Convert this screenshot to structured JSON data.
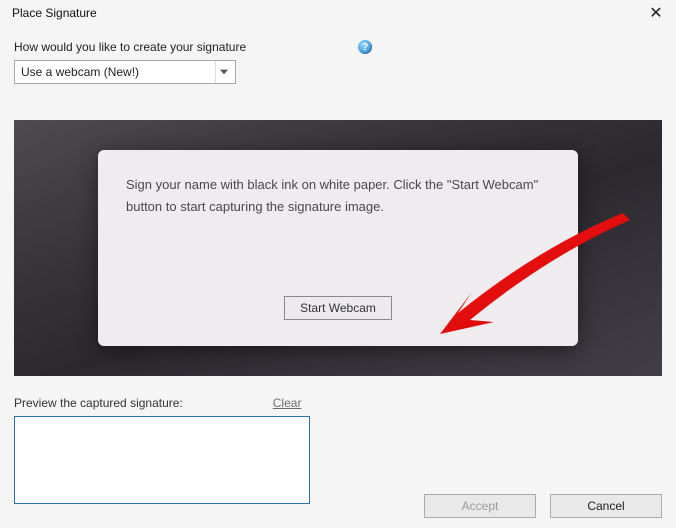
{
  "title": "Place Signature",
  "question": "How would you like to create your signature",
  "dropdown_value": "Use a webcam (New!)",
  "card_text": "Sign your name with black ink on white paper. Click the \"Start Webcam\" button to start capturing the signature image.",
  "start_label": "Start Webcam",
  "preview_label": "Preview the captured signature:",
  "clear_label": "Clear",
  "accept_label": "Accept",
  "cancel_label": "Cancel"
}
